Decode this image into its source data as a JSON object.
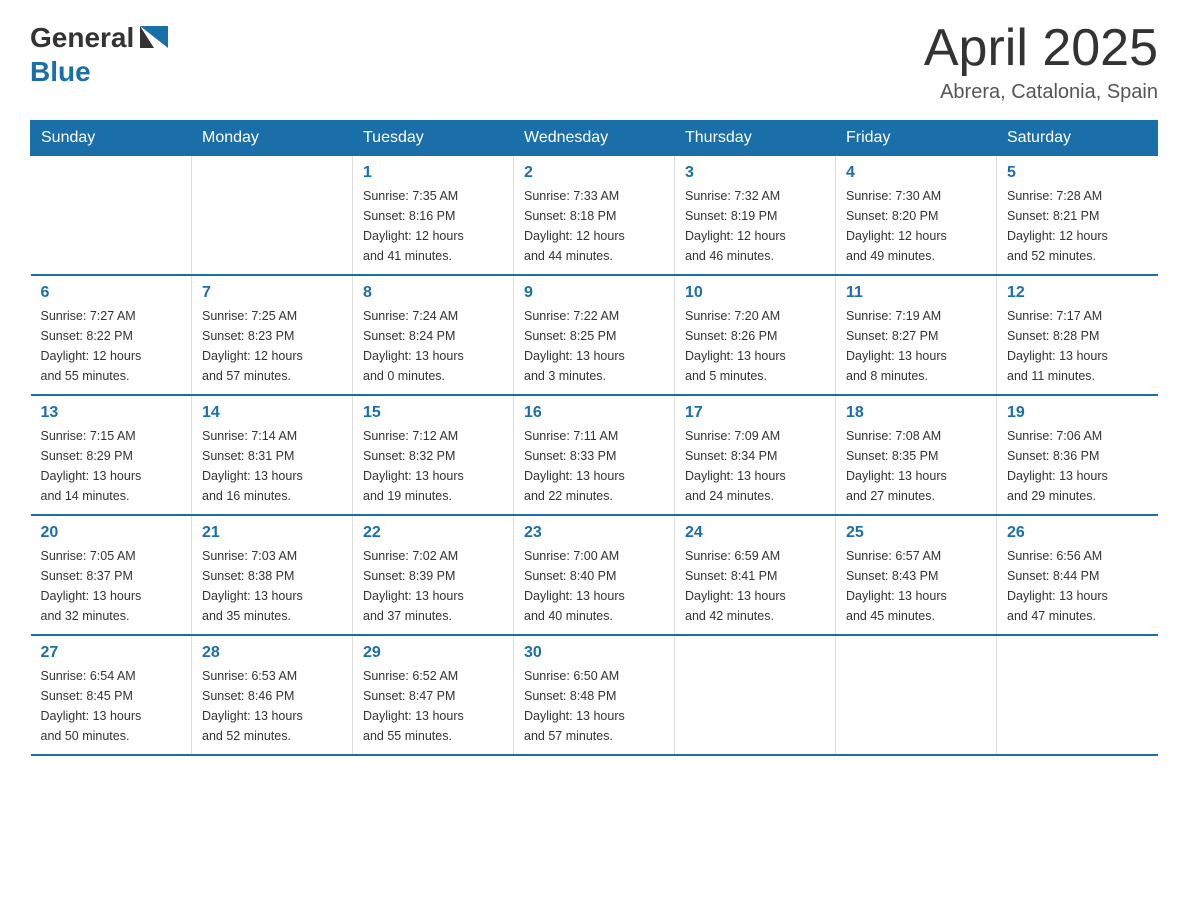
{
  "header": {
    "logo": {
      "text1": "General",
      "text2": "Blue"
    },
    "title": "April 2025",
    "subtitle": "Abrera, Catalonia, Spain"
  },
  "days_of_week": [
    "Sunday",
    "Monday",
    "Tuesday",
    "Wednesday",
    "Thursday",
    "Friday",
    "Saturday"
  ],
  "weeks": [
    [
      {
        "day": "",
        "info": ""
      },
      {
        "day": "",
        "info": ""
      },
      {
        "day": "1",
        "info": "Sunrise: 7:35 AM\nSunset: 8:16 PM\nDaylight: 12 hours\nand 41 minutes."
      },
      {
        "day": "2",
        "info": "Sunrise: 7:33 AM\nSunset: 8:18 PM\nDaylight: 12 hours\nand 44 minutes."
      },
      {
        "day": "3",
        "info": "Sunrise: 7:32 AM\nSunset: 8:19 PM\nDaylight: 12 hours\nand 46 minutes."
      },
      {
        "day": "4",
        "info": "Sunrise: 7:30 AM\nSunset: 8:20 PM\nDaylight: 12 hours\nand 49 minutes."
      },
      {
        "day": "5",
        "info": "Sunrise: 7:28 AM\nSunset: 8:21 PM\nDaylight: 12 hours\nand 52 minutes."
      }
    ],
    [
      {
        "day": "6",
        "info": "Sunrise: 7:27 AM\nSunset: 8:22 PM\nDaylight: 12 hours\nand 55 minutes."
      },
      {
        "day": "7",
        "info": "Sunrise: 7:25 AM\nSunset: 8:23 PM\nDaylight: 12 hours\nand 57 minutes."
      },
      {
        "day": "8",
        "info": "Sunrise: 7:24 AM\nSunset: 8:24 PM\nDaylight: 13 hours\nand 0 minutes."
      },
      {
        "day": "9",
        "info": "Sunrise: 7:22 AM\nSunset: 8:25 PM\nDaylight: 13 hours\nand 3 minutes."
      },
      {
        "day": "10",
        "info": "Sunrise: 7:20 AM\nSunset: 8:26 PM\nDaylight: 13 hours\nand 5 minutes."
      },
      {
        "day": "11",
        "info": "Sunrise: 7:19 AM\nSunset: 8:27 PM\nDaylight: 13 hours\nand 8 minutes."
      },
      {
        "day": "12",
        "info": "Sunrise: 7:17 AM\nSunset: 8:28 PM\nDaylight: 13 hours\nand 11 minutes."
      }
    ],
    [
      {
        "day": "13",
        "info": "Sunrise: 7:15 AM\nSunset: 8:29 PM\nDaylight: 13 hours\nand 14 minutes."
      },
      {
        "day": "14",
        "info": "Sunrise: 7:14 AM\nSunset: 8:31 PM\nDaylight: 13 hours\nand 16 minutes."
      },
      {
        "day": "15",
        "info": "Sunrise: 7:12 AM\nSunset: 8:32 PM\nDaylight: 13 hours\nand 19 minutes."
      },
      {
        "day": "16",
        "info": "Sunrise: 7:11 AM\nSunset: 8:33 PM\nDaylight: 13 hours\nand 22 minutes."
      },
      {
        "day": "17",
        "info": "Sunrise: 7:09 AM\nSunset: 8:34 PM\nDaylight: 13 hours\nand 24 minutes."
      },
      {
        "day": "18",
        "info": "Sunrise: 7:08 AM\nSunset: 8:35 PM\nDaylight: 13 hours\nand 27 minutes."
      },
      {
        "day": "19",
        "info": "Sunrise: 7:06 AM\nSunset: 8:36 PM\nDaylight: 13 hours\nand 29 minutes."
      }
    ],
    [
      {
        "day": "20",
        "info": "Sunrise: 7:05 AM\nSunset: 8:37 PM\nDaylight: 13 hours\nand 32 minutes."
      },
      {
        "day": "21",
        "info": "Sunrise: 7:03 AM\nSunset: 8:38 PM\nDaylight: 13 hours\nand 35 minutes."
      },
      {
        "day": "22",
        "info": "Sunrise: 7:02 AM\nSunset: 8:39 PM\nDaylight: 13 hours\nand 37 minutes."
      },
      {
        "day": "23",
        "info": "Sunrise: 7:00 AM\nSunset: 8:40 PM\nDaylight: 13 hours\nand 40 minutes."
      },
      {
        "day": "24",
        "info": "Sunrise: 6:59 AM\nSunset: 8:41 PM\nDaylight: 13 hours\nand 42 minutes."
      },
      {
        "day": "25",
        "info": "Sunrise: 6:57 AM\nSunset: 8:43 PM\nDaylight: 13 hours\nand 45 minutes."
      },
      {
        "day": "26",
        "info": "Sunrise: 6:56 AM\nSunset: 8:44 PM\nDaylight: 13 hours\nand 47 minutes."
      }
    ],
    [
      {
        "day": "27",
        "info": "Sunrise: 6:54 AM\nSunset: 8:45 PM\nDaylight: 13 hours\nand 50 minutes."
      },
      {
        "day": "28",
        "info": "Sunrise: 6:53 AM\nSunset: 8:46 PM\nDaylight: 13 hours\nand 52 minutes."
      },
      {
        "day": "29",
        "info": "Sunrise: 6:52 AM\nSunset: 8:47 PM\nDaylight: 13 hours\nand 55 minutes."
      },
      {
        "day": "30",
        "info": "Sunrise: 6:50 AM\nSunset: 8:48 PM\nDaylight: 13 hours\nand 57 minutes."
      },
      {
        "day": "",
        "info": ""
      },
      {
        "day": "",
        "info": ""
      },
      {
        "day": "",
        "info": ""
      }
    ]
  ],
  "accent_color": "#1a6fa8"
}
